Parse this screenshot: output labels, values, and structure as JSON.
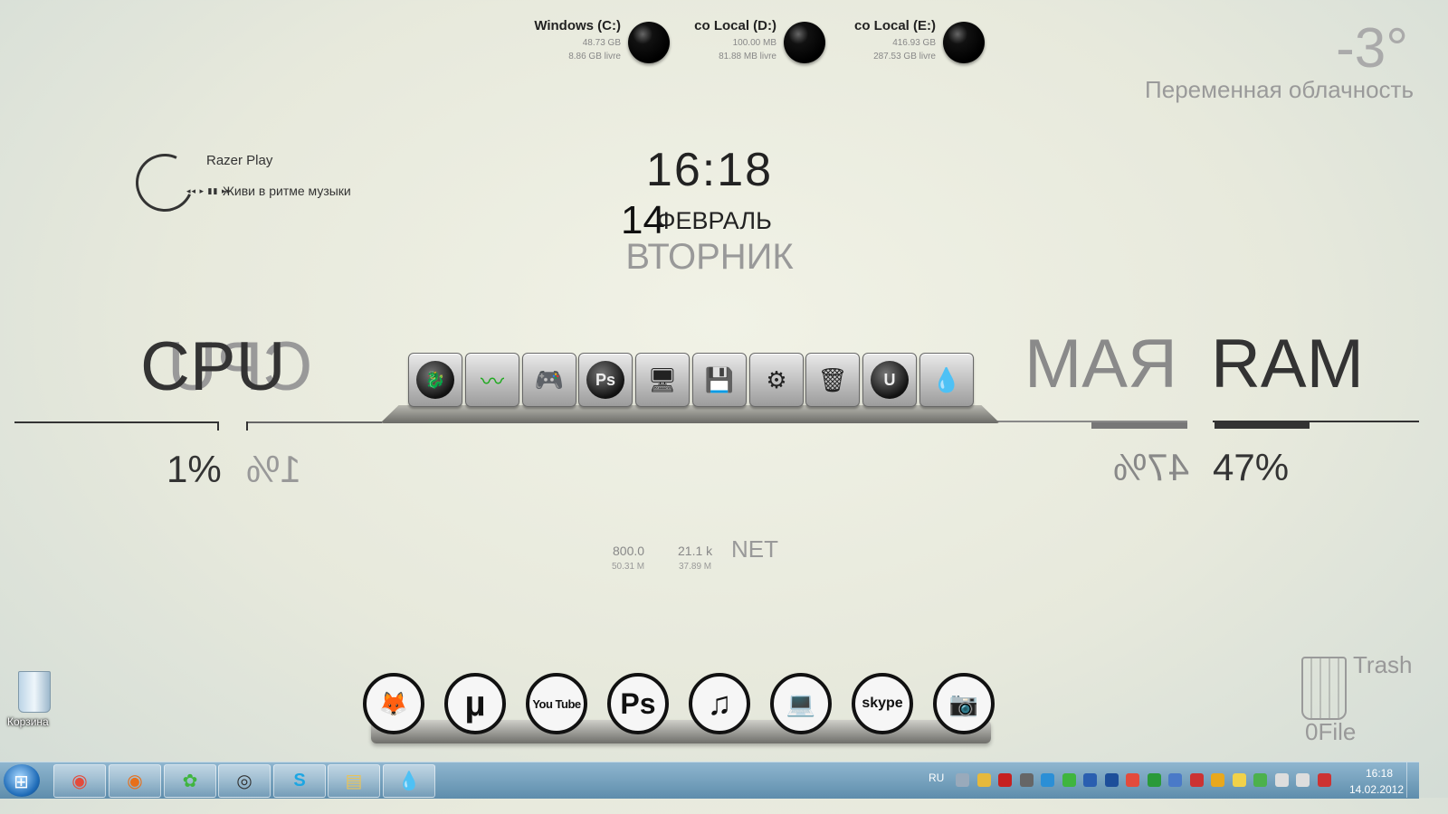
{
  "drives": [
    {
      "name": "Windows (C:)",
      "total": "48.73 GB",
      "free": "8.86 GB livre"
    },
    {
      "name": "co Local (D:)",
      "total": "100.00 MB",
      "free": "81.88 MB livre"
    },
    {
      "name": "co Local (E:)",
      "total": "416.93 GB",
      "free": "287.53 GB livre"
    }
  ],
  "weather": {
    "temp": "-3°",
    "desc": "Переменная облачность"
  },
  "player": {
    "title": "Razer Play",
    "controls": "◂◂ ▸ ▮▮ ▸▸",
    "subtitle": "Живи в ритме музыки"
  },
  "clock": {
    "time": "16:18",
    "day": "14",
    "month": "ФЕВРАЛЬ",
    "weekday": "ВТОРНИК"
  },
  "cpu": {
    "label": "CPU",
    "mirror": "CPU",
    "percent": "1%",
    "percent_mirror": "1%",
    "level": 0.01
  },
  "ram": {
    "label": "RAM",
    "mirror": "MAЯ",
    "percent": "47%",
    "percent_mirror": "47%",
    "level": 0.47
  },
  "top_dock": [
    {
      "name": "dragon-app",
      "glyph": "🐉"
    },
    {
      "name": "activity-monitor",
      "glyph": "〰"
    },
    {
      "name": "gamepad",
      "glyph": "🎮"
    },
    {
      "name": "photoshop",
      "glyph": "Ps"
    },
    {
      "name": "display",
      "glyph": "🖥"
    },
    {
      "name": "floppy-save",
      "glyph": "💾"
    },
    {
      "name": "settings-panel",
      "glyph": "⚙"
    },
    {
      "name": "recycle-bin",
      "glyph": "🗑"
    },
    {
      "name": "unreal",
      "glyph": "U"
    },
    {
      "name": "droplet",
      "glyph": "💧"
    }
  ],
  "net": {
    "label": "NET",
    "up": "800.0",
    "up_total": "50.31 M",
    "down": "21.1 k",
    "down_total": "37.89 M"
  },
  "bottom_dock": [
    {
      "name": "firefox",
      "glyph": "🦊"
    },
    {
      "name": "utorrent",
      "glyph": "µ"
    },
    {
      "name": "youtube",
      "glyph": "You Tube"
    },
    {
      "name": "photoshop",
      "glyph": "Ps"
    },
    {
      "name": "music",
      "glyph": "♫"
    },
    {
      "name": "computer",
      "glyph": "💻"
    },
    {
      "name": "skype",
      "glyph": "skype"
    },
    {
      "name": "camera",
      "glyph": "📷"
    }
  ],
  "desktop": {
    "recycle_label": "Корзина",
    "trash_label": "Trash",
    "trash_count": "0File"
  },
  "taskbar": {
    "apps": [
      {
        "name": "chrome",
        "glyph": "◉",
        "color": "#e34b3c"
      },
      {
        "name": "firefox",
        "glyph": "◉",
        "color": "#e86f1a"
      },
      {
        "name": "icq",
        "glyph": "✿",
        "color": "#3fb53f"
      },
      {
        "name": "steam",
        "glyph": "◎",
        "color": "#333333"
      },
      {
        "name": "skype",
        "glyph": "S",
        "color": "#1ca6e3"
      },
      {
        "name": "explorer",
        "glyph": "▤",
        "color": "#e8c35a"
      },
      {
        "name": "droplet",
        "glyph": "💧",
        "color": "#dddddd"
      }
    ],
    "lang": "RU",
    "tray": [
      {
        "name": "droplet",
        "color": "#9ab"
      },
      {
        "name": "folder",
        "color": "#e6b93c"
      },
      {
        "name": "adobe",
        "color": "#c62020"
      },
      {
        "name": "tool",
        "color": "#666"
      },
      {
        "name": "network",
        "color": "#2b8fd6"
      },
      {
        "name": "icq",
        "color": "#3fb53f"
      },
      {
        "name": "b-app",
        "color": "#2a5fb0"
      },
      {
        "name": "download",
        "color": "#1d4f9a"
      },
      {
        "name": "chrome",
        "color": "#e34b3c"
      },
      {
        "name": "m-app",
        "color": "#2a9a3a"
      },
      {
        "name": "globe",
        "color": "#4a7ac8"
      },
      {
        "name": "flag",
        "color": "#c33"
      },
      {
        "name": "sync",
        "color": "#e9a81d"
      },
      {
        "name": "lightbulb",
        "color": "#f1d24a"
      },
      {
        "name": "battery",
        "color": "#4cb14c"
      },
      {
        "name": "monitor",
        "color": "#ddd"
      },
      {
        "name": "volume",
        "color": "#ddd"
      },
      {
        "name": "alert",
        "color": "#c33"
      }
    ],
    "time": "16:18",
    "date": "14.02.2012"
  }
}
